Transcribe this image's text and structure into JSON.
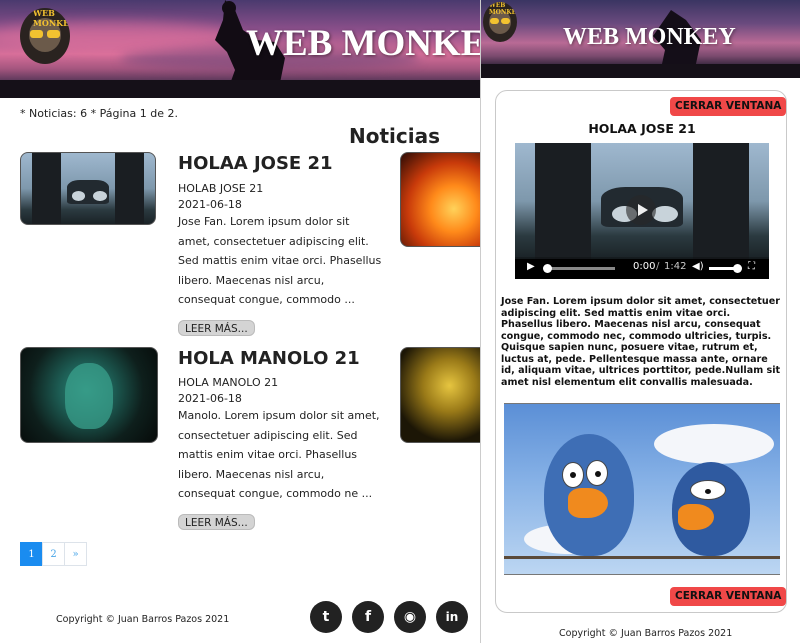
{
  "site": {
    "title": "WEB MONKEY",
    "logo_text": "WEB MONKEY"
  },
  "list_page": {
    "count_line": "* Noticias: 6 * Página 1 de 2.",
    "section_title": "Noticias",
    "items": [
      {
        "title": "HOLAA JOSE 21",
        "subtitle": "HOLAB JOSE 21",
        "date": "2021-06-18",
        "body": "Jose Fan. Lorem ipsum dolor sit amet, consectetuer adipiscing elit. Sed mattis enim vitae orci. Phasellus libero. Maecenas nisl arcu, consequat congue, commodo ...",
        "read_more": "LEER MÁS..."
      },
      {
        "title": "HOLA MANOLO 21",
        "subtitle": "HOLA MANOLO 21",
        "date": "2021-06-18",
        "body": "Manolo. Lorem ipsum dolor sit amet, consectetuer adipiscing elit. Sed mattis enim vitae orci. Phasellus libero. Maecenas nisl arcu, consequat congue, commodo ne ...",
        "read_more": "LEER MÁS..."
      }
    ],
    "pagination": {
      "pages": [
        "1",
        "2"
      ],
      "next": "»",
      "current": "1"
    },
    "footer": "Copyright © Juan Barros Pazos 2021",
    "social": [
      {
        "name": "twitter",
        "glyph": "t"
      },
      {
        "name": "facebook",
        "glyph": "f"
      },
      {
        "name": "github",
        "glyph": "◉"
      },
      {
        "name": "linkedin",
        "glyph": "in"
      }
    ]
  },
  "modal": {
    "close_label": "CERRAR VENTANA",
    "title": "HOLAA JOSE 21",
    "video": {
      "current_time": "0:00",
      "separator": "/",
      "duration": "1:42"
    },
    "body": "Jose Fan. Lorem ipsum dolor sit amet, consectetuer adipiscing elit. Sed mattis enim vitae orci. Phasellus libero. Maecenas nisl arcu, consequat congue, commodo nec, commodo ultricies, turpis. Quisque sapien nunc, posuere vitae, rutrum et, luctus at, pede. Pellentesque massa ante, ornare id, aliquam vitae, ultrices porttitor, pede.Nullam sit amet nisl elementum elit convallis malesuada.",
    "footer": "Copyright © Juan Barros Pazos 2021"
  },
  "colors": {
    "close_button": "#f04848",
    "pagination_active": "#1a8cf0",
    "social_bg": "#222222"
  }
}
